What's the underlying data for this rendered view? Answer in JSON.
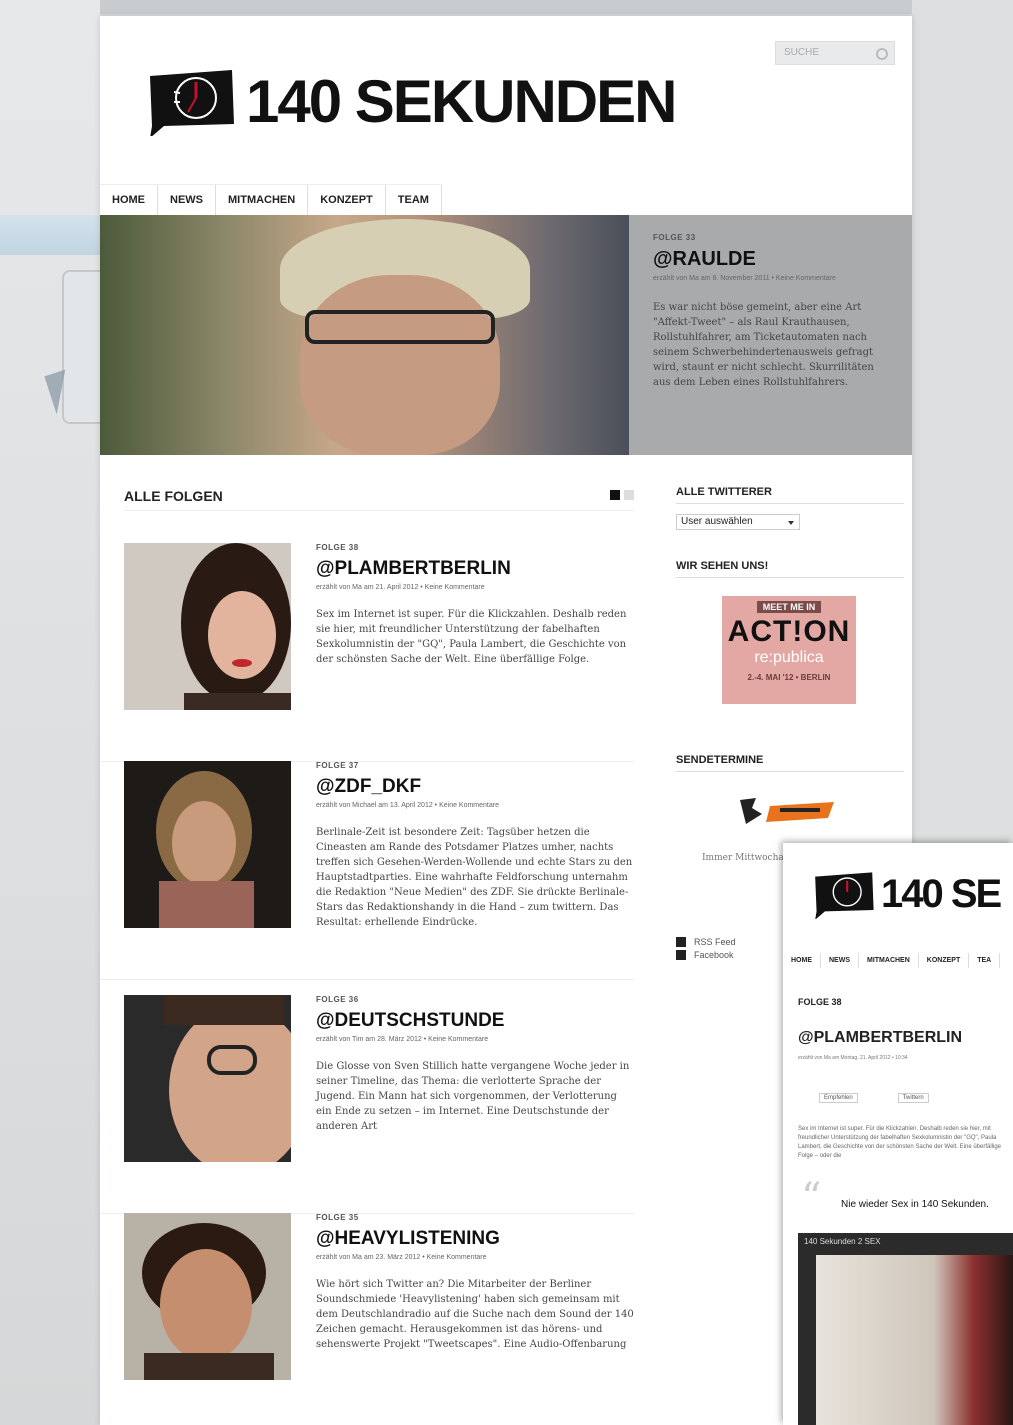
{
  "search": {
    "placeholder": "SUCHE"
  },
  "logo": {
    "text": "140 SEKUNDEN"
  },
  "nav": {
    "items": [
      "HOME",
      "NEWS",
      "MITMACHEN",
      "KONZEPT",
      "TEAM"
    ]
  },
  "hero": {
    "kicker": "FOLGE 33",
    "title": "@RAULDE",
    "meta": "erzählt von Ma am 8. November 2011 • Keine Kommentare",
    "text": "Es war nicht böse gemeint, aber eine Art \"Affekt-Tweet\" – als Raul Krauthausen, Rollstuhlfahrer, am Ticketautomaten nach seinem Schwerbehindertenausweis gefragt wird, staunt er nicht schlecht. Skurrilitäten aus dem Leben eines Rollstuhlfahrers."
  },
  "main": {
    "section_title": "ALLE FOLGEN",
    "episodes": [
      {
        "kicker": "FOLGE 38",
        "title": "@PLAMBERTBERLIN",
        "meta": "erzählt von Ma am 21. April 2012 • Keine Kommentare",
        "text": "Sex im Internet ist super. Für die Klickzahlen. Deshalb reden sie hier, mit freundlicher Unterstützung der fabelhaften Sexkolumnistin der \"GQ\", Paula Lambert, die Geschichte von der schönsten Sache der Welt. Eine überfällige Folge."
      },
      {
        "kicker": "FOLGE 37",
        "title": "@ZDF_DKF",
        "meta": "erzählt von Michael am 13. April 2012 • Keine Kommentare",
        "text": "Berlinale-Zeit ist besondere Zeit: Tagsüber hetzen die Cineasten am Rande des Potsdamer Platzes umher, nachts treffen sich Gesehen-Werden-Wollende und echte Stars zu den Hauptstadtparties. Eine wahrhafte Feldforschung unternahm die Redaktion \"Neue Medien\" des ZDF. Sie drückte Berlinale-Stars das Redaktionshandy in die Hand – zum twittern. Das Resultat: erhellende Eindrücke."
      },
      {
        "kicker": "FOLGE 36",
        "title": "@DEUTSCHSTUNDE",
        "meta": "erzählt von Tim am 28. März 2012 • Keine Kommentare",
        "text": "Die Glosse von Sven Stillich hatte vergangene Woche jeder in seiner Timeline, das Thema: die verlotterte Sprache der Jugend. Ein Mann hat sich vorgenommen, der Verlotterung ein Ende zu setzen – im Internet. Eine Deutschstunde der anderen Art"
      },
      {
        "kicker": "FOLGE 35",
        "title": "@HEAVYLISTENING",
        "meta": "erzählt von Ma am 23. März 2012 • Keine Kommentare",
        "text": "Wie hört sich Twitter an? Die Mitarbeiter der Berliner Soundschmiede 'Heavylistening' haben sich gemeinsam mit dem Deutschlandradio auf die Suche nach dem Sound der 140 Zeichen gemacht. Herausgekommen ist das hörens- und sehenswerte Projekt \"Tweetscapes\". Eine Audio-Offenbarung"
      }
    ]
  },
  "sidebar": {
    "twitterer_title": "ALLE TWITTERER",
    "select_value": "User auswählen",
    "wir_sehen_title": "WIR SEHEN UNS!",
    "action_banner": {
      "line1": "MEET ME IN",
      "line2": "ACT!ON",
      "line3": "re:publica",
      "line4": "2.-4. MAI '12 • BERLIN"
    },
    "sendetermine_title": "SENDETERMINE",
    "sendetermine_text": "Immer Mittwochabends auf ZDFinfo",
    "links": [
      "RSS Feed",
      "Facebook"
    ]
  },
  "overlay": {
    "logo_text": "140 SE",
    "nav": [
      "HOME",
      "NEWS",
      "MITMACHEN",
      "KONZEPT",
      "TEA"
    ],
    "kicker": "FOLGE 38",
    "title": "@PLAMBERTBERLIN",
    "meta": "erzählt von Ma am Montag, 21. April 2012 • 10:34",
    "buttons": [
      "Empfehlen",
      "Twittern"
    ],
    "text": "Sex im Internet ist super. Für die Klickzahlen. Deshalb reden sie hier, mit freundlicher Unterstützung der fabelhaften Sexkolumnistin der \"GQ\", Paula Lambert, die Geschichte von der schönsten Sache der Welt. Eine überfällige Folge – oder die",
    "quote": "Nie wieder Sex in 140 Sekunden.",
    "video_title": "140 Sekunden 2 SEX"
  },
  "colors": {
    "hero_info_bg": "#a9aaab",
    "accent_red": "#c8102e",
    "page_bg": "#ffffff"
  }
}
